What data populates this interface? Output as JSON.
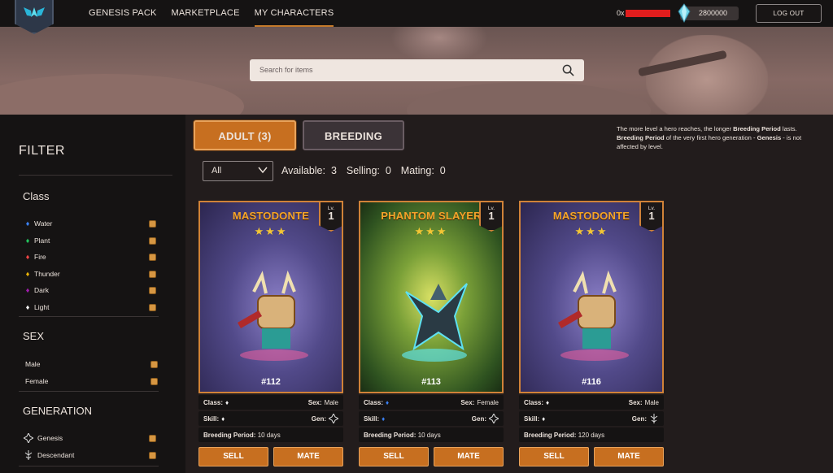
{
  "nav": {
    "items": [
      "GENESIS PACK",
      "MARKETPLACE",
      "MY CHARACTERS"
    ],
    "active_index": 2
  },
  "header": {
    "wallet_prefix": "0x",
    "balance": "2800000",
    "logout_label": "LOG OUT"
  },
  "search": {
    "placeholder": "Search for items"
  },
  "sidebar": {
    "title": "FILTER",
    "class_title": "Class",
    "classes": [
      {
        "label": "Water",
        "color": "#3b82f6"
      },
      {
        "label": "Plant",
        "color": "#22c55e"
      },
      {
        "label": "Fire",
        "color": "#ef4444"
      },
      {
        "label": "Thunder",
        "color": "#eab308"
      },
      {
        "label": "Dark",
        "color": "#a21caf"
      },
      {
        "label": "Light",
        "color": "#f5f5f5"
      }
    ],
    "sex_title": "SEX",
    "sexes": [
      "Male",
      "Female"
    ],
    "generation_title": "GENERATION",
    "generations": [
      "Genesis",
      "Descendant"
    ]
  },
  "tabs": {
    "adult": "ADULT (3)",
    "breeding": "BREEDING"
  },
  "note": {
    "p1": "The more level a hero reaches, the longer ",
    "b1": "Breeding Period",
    "p2": " lasts. ",
    "b2": "Breeding Period",
    "p3": " of the very first hero generation - ",
    "b3": "Genesis",
    "p4": " - is not affected by level."
  },
  "controls": {
    "select_value": "All",
    "available_label": "Available:",
    "available_value": "3",
    "selling_label": "Selling:",
    "selling_value": "0",
    "mating_label": "Mating:",
    "mating_value": "0"
  },
  "labels": {
    "class": "Class:",
    "sex": "Sex:",
    "skill": "Skill:",
    "gen": "Gen:",
    "breeding_period": "Breeding Period:",
    "lv": "Lv.",
    "sell": "SELL",
    "mate": "MATE"
  },
  "cards": [
    {
      "name": "MASTODONTE",
      "stars": "★★★",
      "level": "1",
      "id": "#112",
      "sex": "Male",
      "class_color": "#f5f5f5",
      "skill_color": "#f5f5f5",
      "breeding_period": "10 days",
      "gen_icon": "genesis-icon",
      "art": "purple"
    },
    {
      "name": "PHANTOM SLAYER",
      "stars": "★★★",
      "level": "1",
      "id": "#113",
      "sex": "Female",
      "class_color": "#3b82f6",
      "skill_color": "#3b82f6",
      "breeding_period": "10 days",
      "gen_icon": "genesis-icon",
      "art": "green"
    },
    {
      "name": "MASTODONTE",
      "stars": "★★★",
      "level": "1",
      "id": "#116",
      "sex": "Male",
      "class_color": "#f5f5f5",
      "skill_color": "#f5f5f5",
      "breeding_period": "120 days",
      "gen_icon": "descendant-icon",
      "art": "purple"
    }
  ]
}
